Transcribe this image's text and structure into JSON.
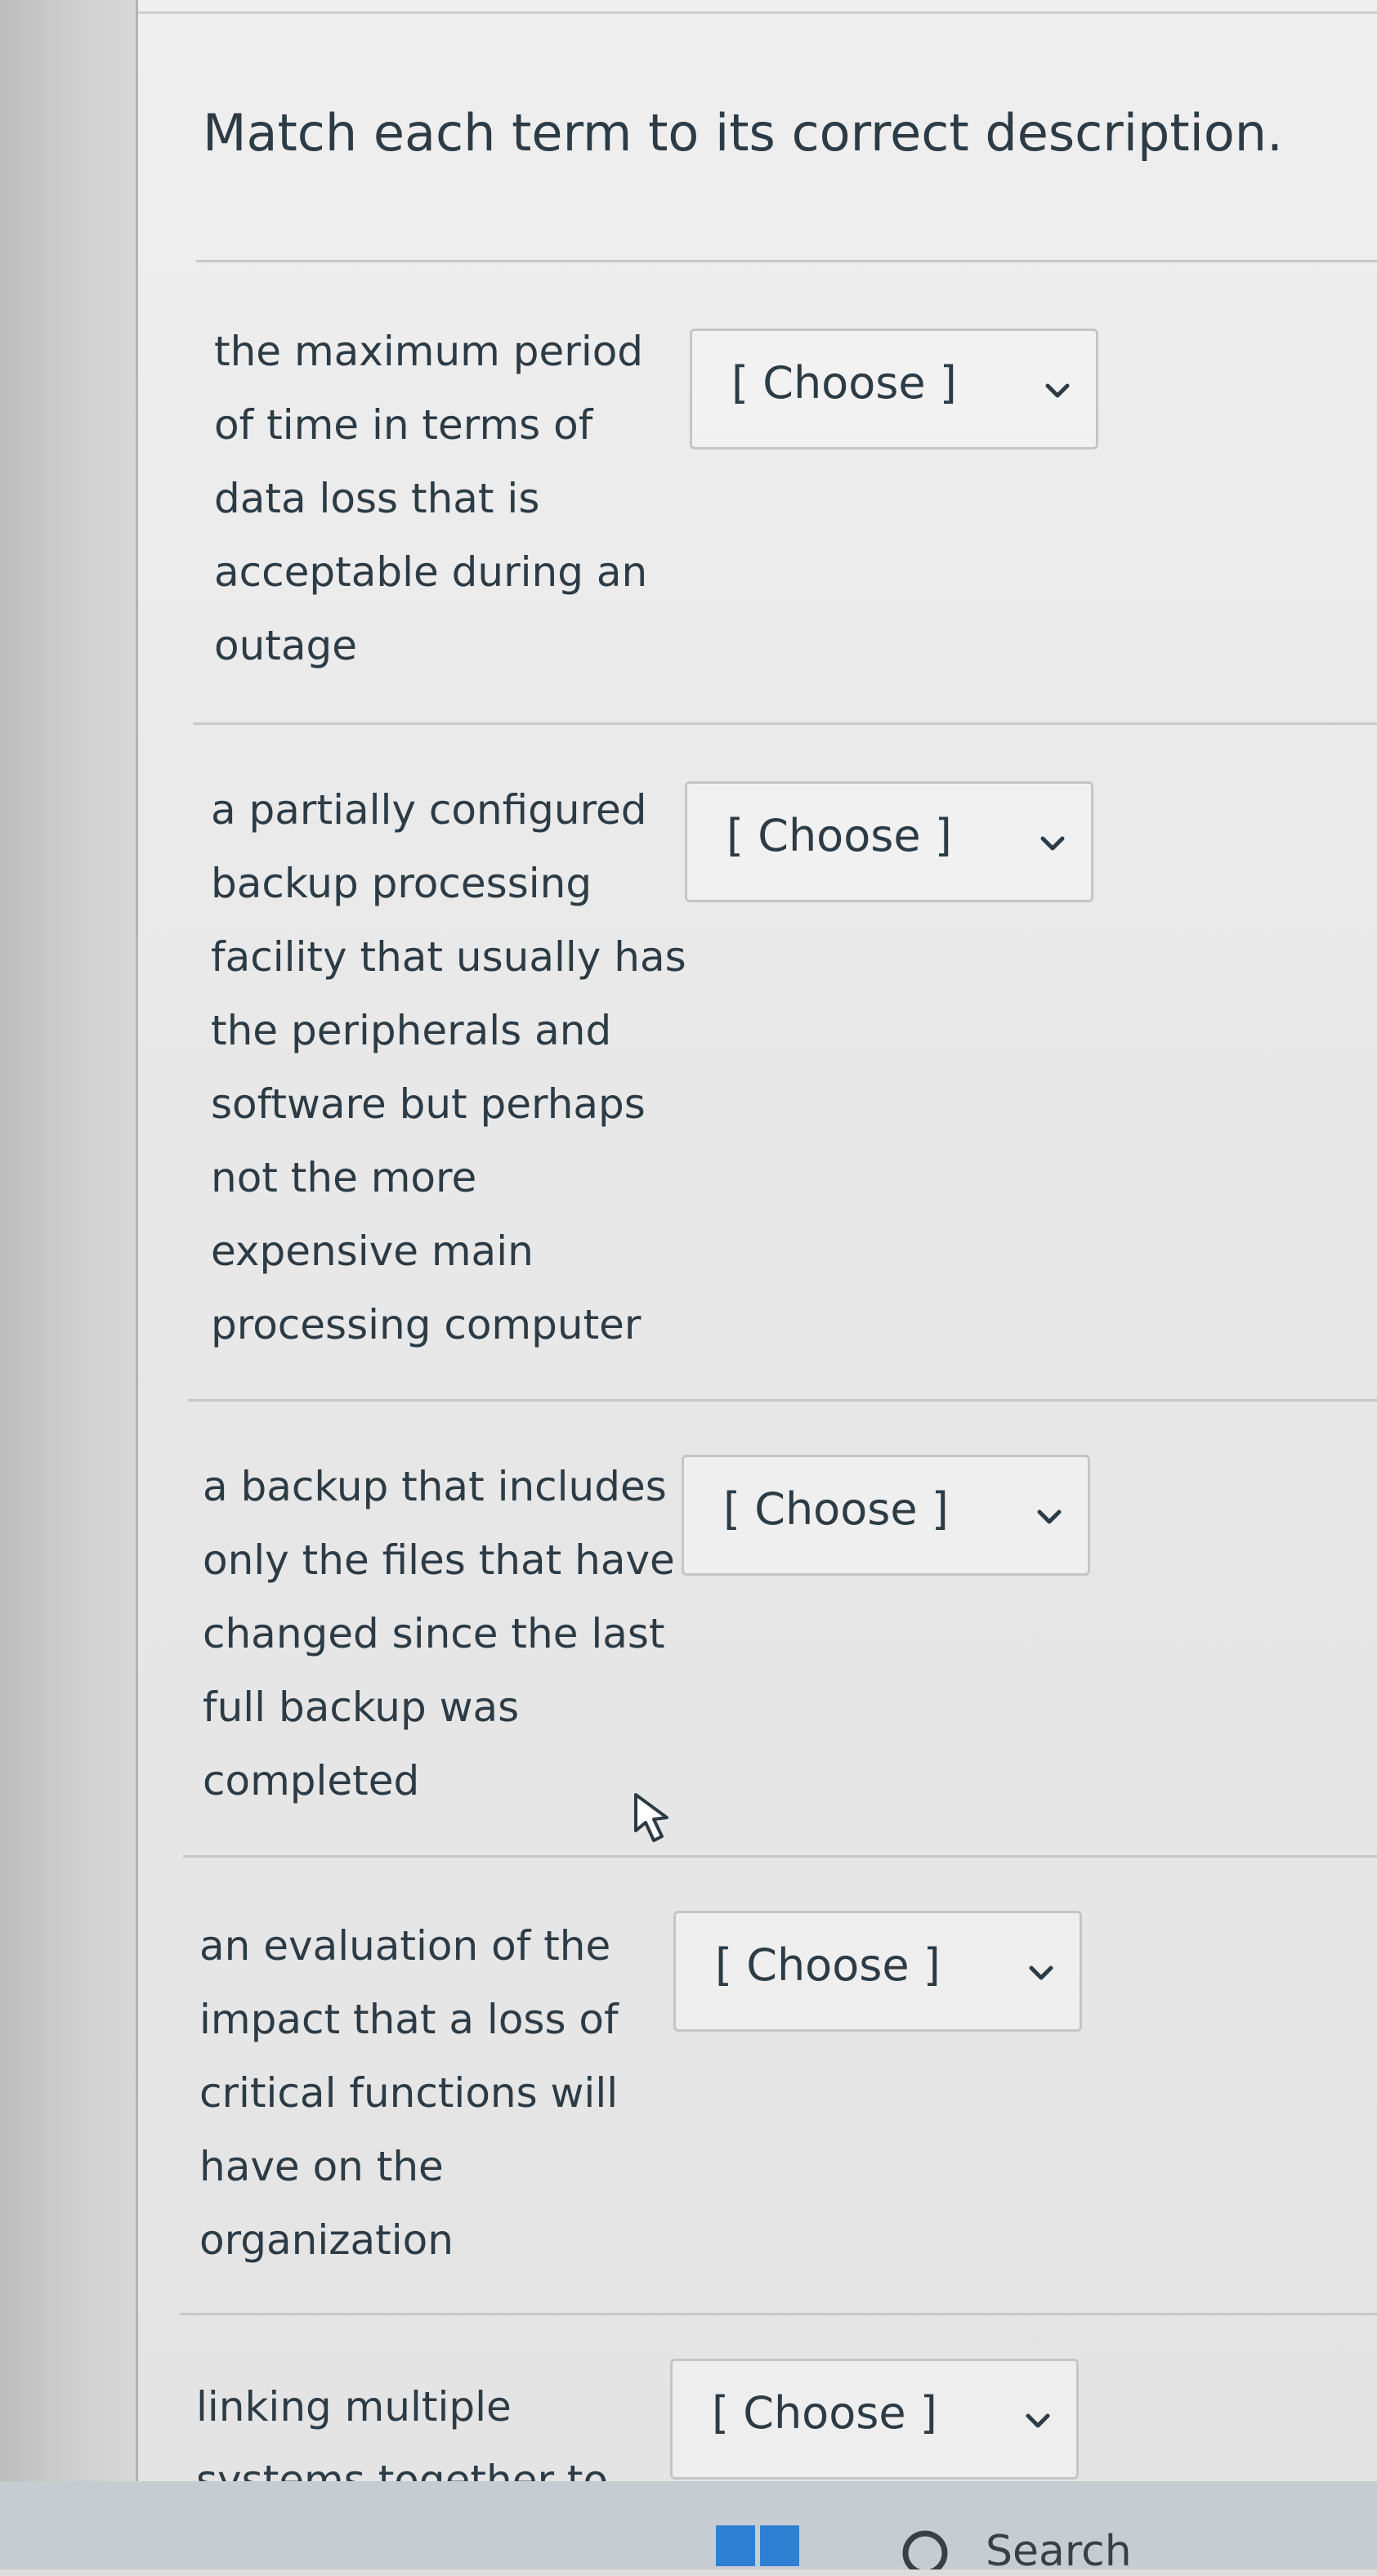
{
  "quiz": {
    "instruction": "Match each term to its correct description.",
    "items": [
      {
        "description_lines": [
          "the maximum period",
          "of time in terms of",
          "data loss that is",
          "acceptable during an",
          "outage"
        ],
        "select_value": "[ Choose ]"
      },
      {
        "description_lines": [
          "a partially configured",
          "backup processing",
          "facility that usually has",
          "the peripherals and",
          "software but perhaps",
          "not the more",
          "expensive main",
          "processing computer"
        ],
        "select_value": "[ Choose ]"
      },
      {
        "description_lines": [
          "a backup that includes",
          "only the files that have",
          "changed since the last",
          "full backup was",
          "completed"
        ],
        "select_value": "[ Choose ]"
      },
      {
        "description_lines": [
          "an evaluation of the",
          "impact that a loss of",
          "critical functions will",
          "have on the",
          "organization"
        ],
        "select_value": "[ Choose ]"
      },
      {
        "description_lines": [
          "linking multiple",
          "systems together to"
        ],
        "select_value": "[ Choose ]"
      }
    ]
  },
  "taskbar": {
    "start_icon": "windows-start-icon",
    "search_icon": "search-icon",
    "search_label": "Search"
  },
  "colors": {
    "text": "#2d3b45",
    "border": "#c5c5c5",
    "background": "#e8e8e8"
  }
}
